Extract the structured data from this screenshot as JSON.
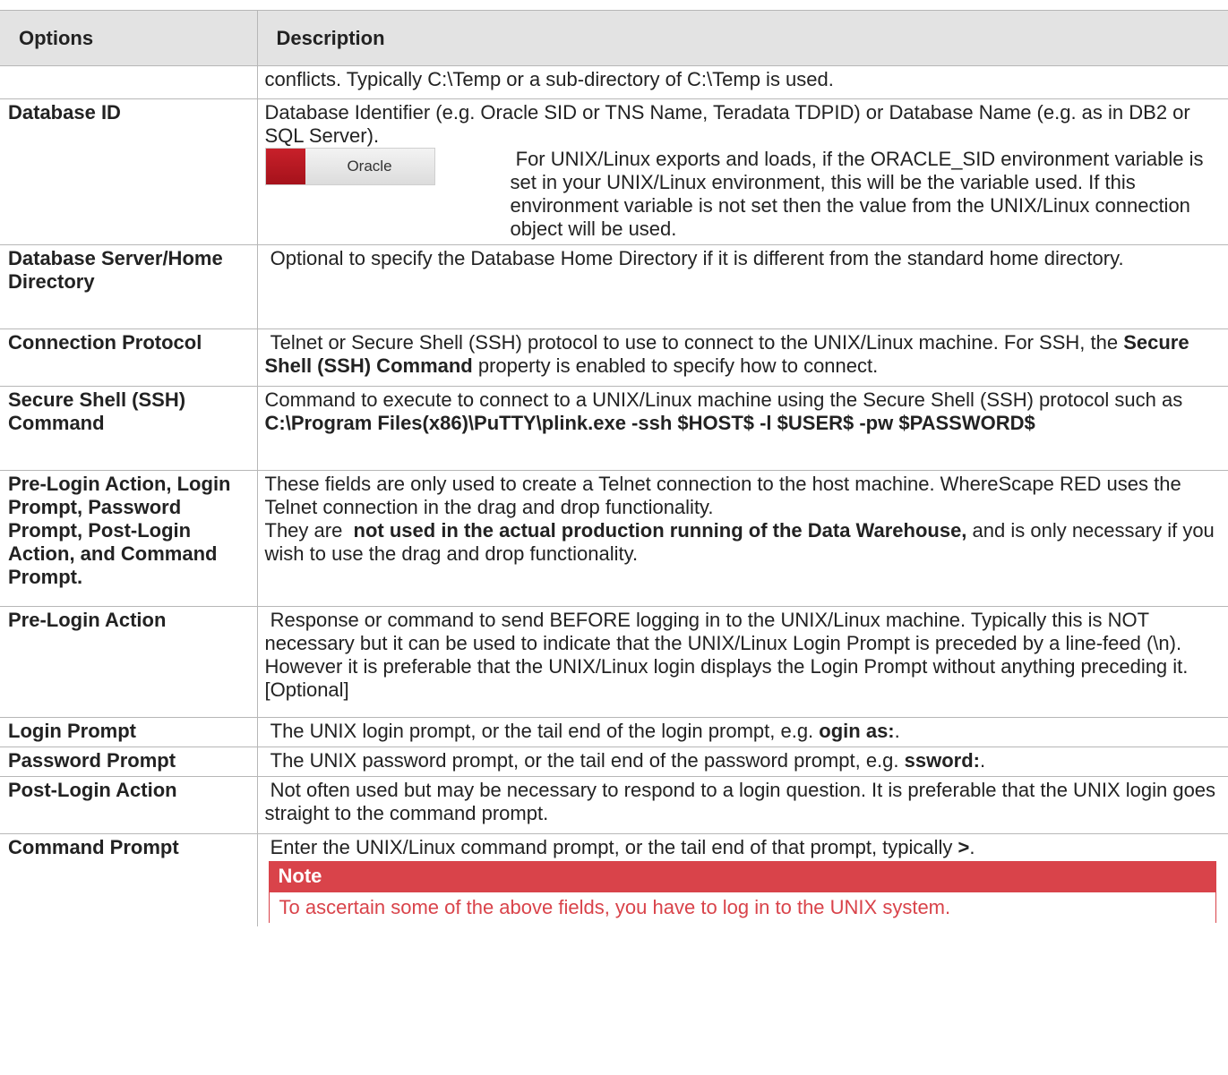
{
  "header": {
    "options": "Options",
    "description": "Description"
  },
  "rows": [
    {
      "option": "",
      "description": "conflicts. Typically C:\\Temp or a sub-directory of C:\\Temp is used."
    },
    {
      "option": "Database ID",
      "description": "Database Identifier (e.g. Oracle SID or TNS Name, Teradata TDPID) or Database Name (e.g. as in DB2 or SQL Server).",
      "logo_text": "Oracle",
      "logo_note": " For UNIX/Linux exports and loads, if the ORACLE_SID environment variable is set in your UNIX/Linux environment, this will be the variable used. If this environment variable is not set then the value from the UNIX/Linux connection object will be used."
    },
    {
      "option": "Database Server/Home Directory",
      "description": " Optional to specify the Database Home Directory if it is different from the standard home directory."
    },
    {
      "option": "Connection Protocol",
      "description_a": " Telnet or Secure Shell (SSH) protocol to use to connect to the UNIX/Linux machine. For SSH, the ",
      "description_b": "Secure Shell (SSH) Command",
      "description_c": " property is enabled to specify how to connect."
    },
    {
      "option": "Secure Shell (SSH) Command",
      "description_a": "Command to execute to connect to a UNIX/Linux machine using the Secure Shell (SSH) protocol such as ",
      "description_b": "C:\\Program Files(x86)\\PuTTY\\plink.exe -ssh $HOST$ -l $USER$ -pw $PASSWORD$"
    },
    {
      "option": "Pre-Login Action, Login Prompt, Password Prompt, Post-Login Action, and Command Prompt.",
      "description_1": "These fields are only used to create a Telnet connection to the host machine. WhereScape RED uses the Telnet connection in the drag and drop functionality.",
      "description_2a": "They are  ",
      "description_2b": "not used in the actual production running of the Data Warehouse,",
      "description_2c": " and is only necessary if you wish to use the drag and drop functionality."
    },
    {
      "option": "Pre-Login Action",
      "description": " Response or command to send BEFORE logging in to the UNIX/Linux machine. Typically this is NOT necessary but it can be used to indicate that the UNIX/Linux Login Prompt is preceded by a line-feed (\\n). However it is preferable that the UNIX/Linux login displays the Login Prompt without anything preceding it. [Optional]"
    },
    {
      "option": "Login Prompt",
      "description_a": " The UNIX login prompt, or the tail end of the login prompt, e.g. ",
      "description_b": "ogin as:",
      "description_c": "."
    },
    {
      "option": "Password Prompt",
      "description_a": " The UNIX password prompt, or the tail end of the password prompt, e.g. ",
      "description_b": "ssword:",
      "description_c": "."
    },
    {
      "option": "Post-Login Action",
      "description": " Not often used but may be necessary to respond to a login question. It is preferable that the UNIX login goes straight to the command prompt."
    },
    {
      "option": "Command Prompt",
      "description_a": " Enter the UNIX/Linux command prompt, or the tail end of that prompt, typically ",
      "description_b": ">",
      "description_c": ".",
      "note_title": "Note",
      "note_text": "To ascertain some of the above fields, you have to log in to the UNIX system."
    }
  ],
  "colors": {
    "header_bg": "#e3e3e3",
    "border": "#b7b7b7",
    "note_red": "#d9434a",
    "oracle_red": "#c8202a"
  },
  "icons": {
    "logo": "oracle-logo"
  }
}
